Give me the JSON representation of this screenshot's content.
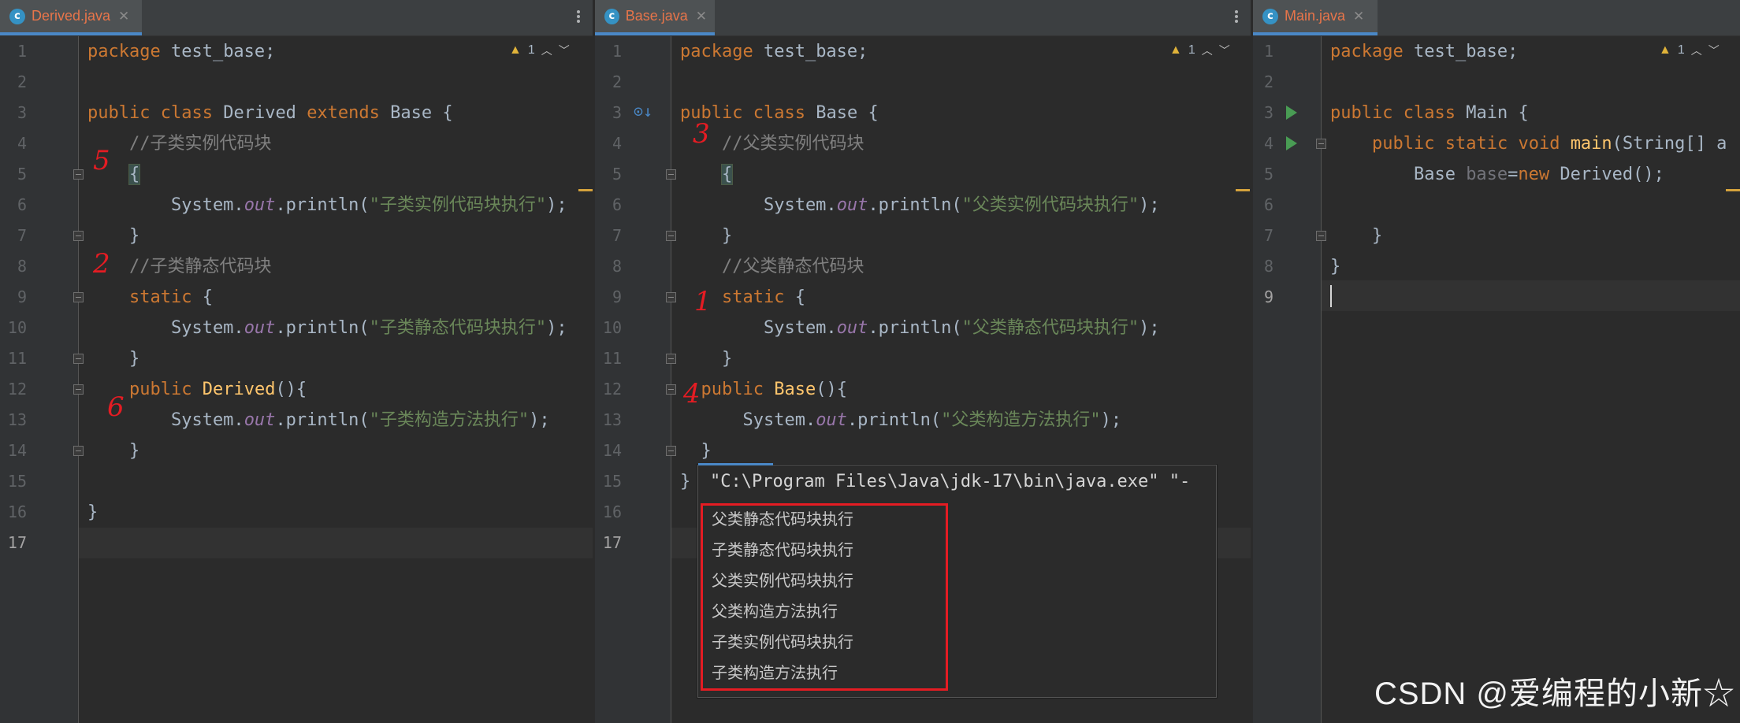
{
  "panes": [
    {
      "tab_label": "Derived.java",
      "warning_count": "1",
      "lines": [
        "package test_base;",
        "",
        "public class Derived extends Base {",
        "    //子类实例代码块",
        "    {",
        "        System.out.println(\"子类实例代码块执行\");",
        "    }",
        "    //子类静态代码块",
        "    static {",
        "        System.out.println(\"子类静态代码块执行\");",
        "    }",
        "    public Derived(){",
        "        System.out.println(\"子类构造方法执行\");",
        "    }",
        "",
        "}",
        ""
      ],
      "line_numbers": [
        "1",
        "2",
        "3",
        "4",
        "5",
        "6",
        "7",
        "8",
        "9",
        "10",
        "11",
        "12",
        "13",
        "14",
        "15",
        "16",
        "17"
      ],
      "annotations": [
        "5",
        "2",
        "6"
      ]
    },
    {
      "tab_label": "Base.java",
      "warning_count": "1",
      "lines": [
        "package test_base;",
        "",
        "public class Base {",
        "    //父类实例代码块",
        "    {",
        "        System.out.println(\"父类实例代码块执行\");",
        "    }",
        "    //父类静态代码块",
        "    static {",
        "        System.out.println(\"父类静态代码块执行\");",
        "    }",
        "  public Base(){",
        "      System.out.println(\"父类构造方法执行\");",
        "  }",
        "}",
        "",
        ""
      ],
      "line_numbers": [
        "1",
        "2",
        "3",
        "4",
        "5",
        "6",
        "7",
        "8",
        "9",
        "10",
        "11",
        "12",
        "13",
        "14",
        "15",
        "16",
        "17"
      ],
      "annotations": [
        "3",
        "1",
        "4"
      ]
    },
    {
      "tab_label": "Main.java",
      "warning_count": "1",
      "lines": [
        "package test_base;",
        "",
        "public class Main {",
        "    public static void main(String[] a",
        "        Base base=new Derived();",
        "",
        "    }",
        "}",
        ""
      ],
      "line_numbers": [
        "1",
        "2",
        "3",
        "4",
        "5",
        "6",
        "7",
        "8",
        "9"
      ]
    }
  ],
  "console": {
    "command": "\"C:\\Program Files\\Java\\jdk-17\\bin\\java.exe\" \"-",
    "output": [
      "父类静态代码块执行",
      "子类静态代码块执行",
      "父类实例代码块执行",
      "父类构造方法执行",
      "子类实例代码块执行",
      "子类构造方法执行"
    ]
  },
  "watermark": "CSDN @爱编程的小新☆",
  "icons": {
    "tab_file_icon": "java-class-icon",
    "close": "close-icon",
    "menu": "more-vertical-icon",
    "warning": "warning-icon",
    "run": "run-gutter-icon",
    "override": "overridden-icon"
  },
  "colors": {
    "keyword": "#cc7832",
    "string": "#6a8759",
    "comment": "#808080",
    "field": "#9876aa",
    "method": "#ffc66d",
    "tab_accent": "#4a88c7",
    "red_annotation": "#e51c23"
  }
}
